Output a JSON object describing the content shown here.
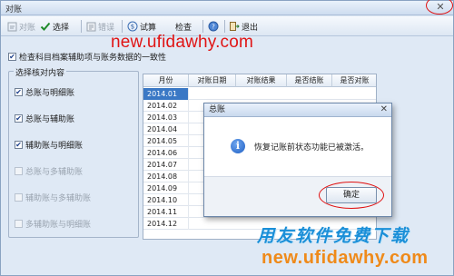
{
  "window": {
    "title": "对账",
    "close_glyph": "✕"
  },
  "toolbar": {
    "items": [
      {
        "label": "对账",
        "icon": "reconcile-icon",
        "enabled": false
      },
      {
        "label": "选择",
        "icon": "checkmark-icon",
        "enabled": true
      },
      {
        "label": "错误",
        "icon": "error-list-icon",
        "enabled": false
      },
      {
        "label": "试算",
        "icon": "calculator-icon",
        "enabled": true
      },
      {
        "label": "检查",
        "icon": "",
        "enabled": true
      },
      {
        "label": "",
        "icon": "help-icon",
        "enabled": true
      },
      {
        "label": "退出",
        "icon": "exit-icon",
        "enabled": true
      }
    ]
  },
  "watermarks": {
    "top": "new.ufidawhy.com",
    "bottom_cn": "用友软件免费下载",
    "bottom_en": "new.ufidawhy.com"
  },
  "main_check": {
    "label": "检查科目档案辅助项与账务数据的一致性",
    "checked": true
  },
  "group": {
    "title": "选择核对内容",
    "options": [
      {
        "label": "总账与明细账",
        "checked": true,
        "enabled": true
      },
      {
        "label": "总账与辅助账",
        "checked": true,
        "enabled": true
      },
      {
        "label": "辅助账与明细账",
        "checked": true,
        "enabled": true
      },
      {
        "label": "总账与多辅助账",
        "checked": false,
        "enabled": false
      },
      {
        "label": "辅助账与多辅助账",
        "checked": false,
        "enabled": false
      },
      {
        "label": "多辅助账与明细账",
        "checked": false,
        "enabled": false
      }
    ]
  },
  "table": {
    "columns": [
      "月份",
      "对账日期",
      "对账结果",
      "是否结账",
      "是否对账"
    ],
    "rows": [
      {
        "month": "2014.01",
        "selected": true
      },
      {
        "month": "2014.02",
        "selected": false
      },
      {
        "month": "2014.03",
        "selected": false
      },
      {
        "month": "2014.04",
        "selected": false
      },
      {
        "month": "2014.05",
        "selected": false
      },
      {
        "month": "2014.06",
        "selected": false
      },
      {
        "month": "2014.07",
        "selected": false
      },
      {
        "month": "2014.08",
        "selected": false
      },
      {
        "month": "2014.09",
        "selected": false
      },
      {
        "month": "2014.10",
        "selected": false
      },
      {
        "month": "2014.11",
        "selected": false
      },
      {
        "month": "2014.12",
        "selected": false
      }
    ]
  },
  "dialog": {
    "title": "总账",
    "close_glyph": "✕",
    "icon": "info-icon",
    "icon_glyph": "i",
    "message": "恢复记账前状态功能已被激活。",
    "ok_label": "确定"
  },
  "colors": {
    "annotation_red": "#e01010",
    "selected_row": "#3a78c5",
    "watermark_blue": "#1a8fd8",
    "watermark_orange": "#ef8a1a"
  }
}
